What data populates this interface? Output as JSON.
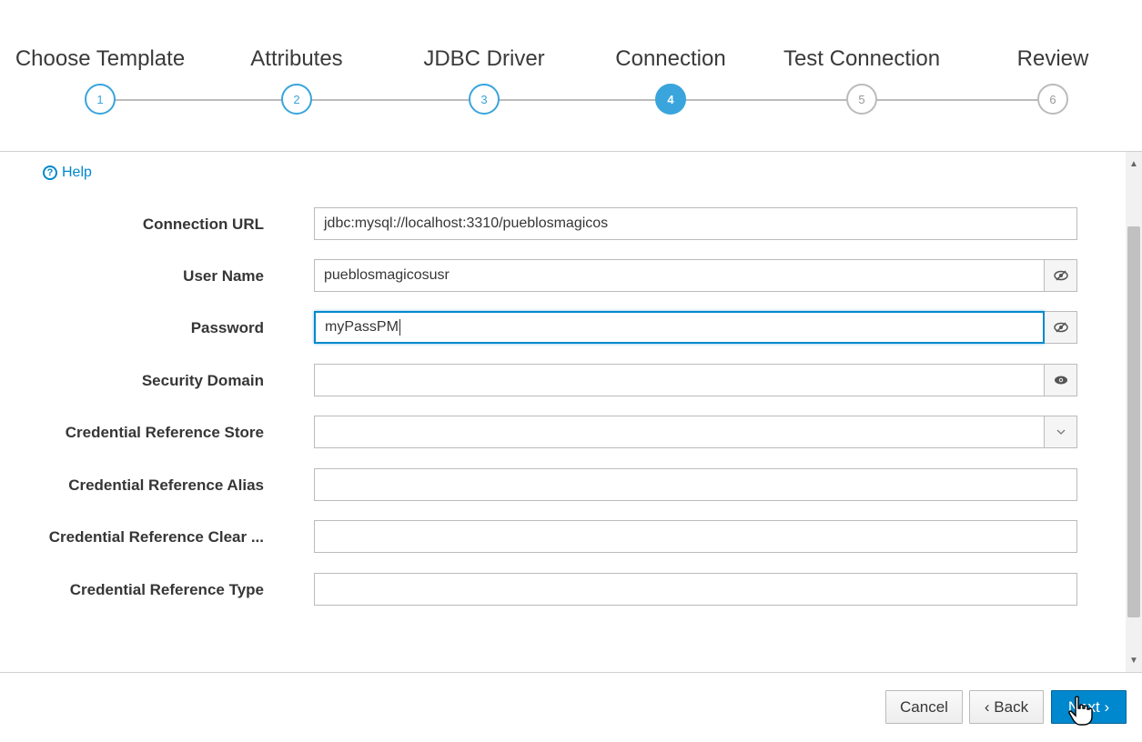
{
  "wizard": {
    "steps": [
      {
        "label": "Choose Template",
        "number": "1"
      },
      {
        "label": "Attributes",
        "number": "2"
      },
      {
        "label": "JDBC Driver",
        "number": "3"
      },
      {
        "label": "Connection",
        "number": "4"
      },
      {
        "label": "Test Connection",
        "number": "5"
      },
      {
        "label": "Review",
        "number": "6"
      }
    ],
    "active_step": 4
  },
  "help": {
    "icon": "question-circle-icon",
    "label": "Help"
  },
  "form": {
    "connection_url": {
      "label": "Connection URL",
      "value": "jdbc:mysql://localhost:3310/pueblosmagicos"
    },
    "user_name": {
      "label": "User Name",
      "value": "pueblosmagicosusr",
      "addon_icon": "eye-slash-icon"
    },
    "password": {
      "label": "Password",
      "value": "myPassPM",
      "addon_icon": "eye-slash-icon"
    },
    "security_domain": {
      "label": "Security Domain",
      "value": "",
      "addon_icon": "eye-icon"
    },
    "credential_reference_store": {
      "label": "Credential Reference Store",
      "value": "",
      "addon_icon": "chevron-down-icon"
    },
    "credential_reference_alias": {
      "label": "Credential Reference Alias",
      "value": ""
    },
    "credential_reference_clear": {
      "label": "Credential Reference Clear ...",
      "value": ""
    },
    "credential_reference_type": {
      "label": "Credential Reference Type",
      "value": ""
    }
  },
  "footer": {
    "cancel_label": "Cancel",
    "back_label": "‹ Back",
    "next_label": "Next ›"
  },
  "colors": {
    "accent": "#39a5dc",
    "primary_button": "#0088ce"
  }
}
